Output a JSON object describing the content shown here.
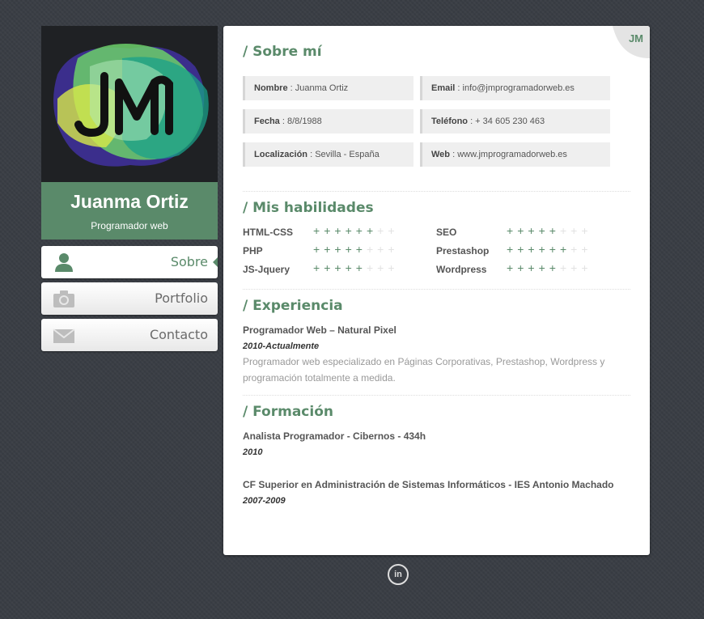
{
  "profile": {
    "logo_text": "JM",
    "name": "Juanma Ortiz",
    "role": "Programador web"
  },
  "nav": {
    "items": [
      {
        "label": "Sobre",
        "icon": "user-icon"
      },
      {
        "label": "Portfolio",
        "icon": "camera-icon"
      },
      {
        "label": "Contacto",
        "icon": "mail-icon"
      }
    ]
  },
  "corner_logo": "JM",
  "about": {
    "title": "/ Sobre mí",
    "fields": [
      {
        "key": "Nombre",
        "value": " : Juanma Ortiz"
      },
      {
        "key": "Email",
        "value": " : info@jmprogramadorweb.es"
      },
      {
        "key": "Fecha",
        "value": " : 8/8/1988"
      },
      {
        "key": "Teléfono",
        "value": " : + 34 605 230 463"
      },
      {
        "key": "Localización",
        "value": " : Sevilla - España"
      },
      {
        "key": "Web",
        "value": " : www.jmprogramadorweb.es"
      }
    ]
  },
  "skills": {
    "title": "/ Mis habilidades",
    "items": [
      {
        "name": "HTML-CSS",
        "level": 6
      },
      {
        "name": "SEO",
        "level": 5
      },
      {
        "name": "PHP",
        "level": 5
      },
      {
        "name": "Prestashop",
        "level": 6
      },
      {
        "name": "JS-Jquery",
        "level": 5
      },
      {
        "name": "Wordpress",
        "level": 5
      }
    ],
    "max": 8
  },
  "experience": {
    "title": "/ Experiencia",
    "job": "Programador Web – Natural Pixel",
    "date": "2010-Actualmente",
    "desc": "Programador web especializado en Páginas Corporativas, Prestashop, Wordpress y programación totalmente a medida."
  },
  "education": {
    "title": "/ Formación",
    "items": [
      {
        "title": "Analista Programador - Cibernos - 434h",
        "date": "2010"
      },
      {
        "title": "CF Superior en Administración de Sistemas Informáticos - IES Antonio Machado",
        "date": "2007-2009"
      }
    ]
  },
  "footer": {
    "social": "in"
  },
  "colors": {
    "accent": "#5a8a6a",
    "background": "#3a3e45"
  }
}
